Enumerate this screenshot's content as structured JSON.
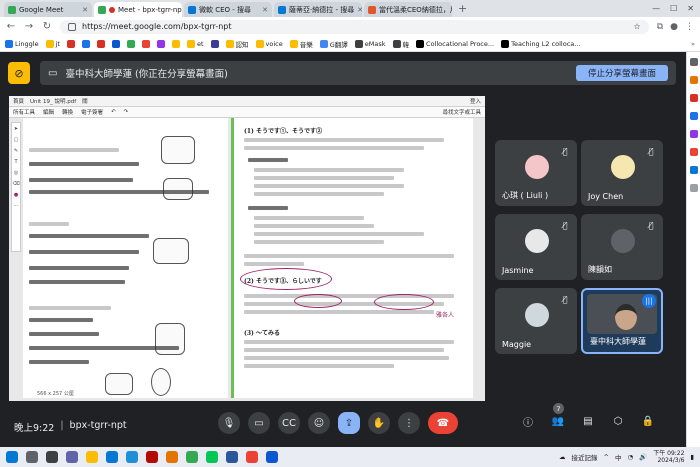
{
  "browser": {
    "tabs": [
      {
        "title": "Google Meet",
        "favicon_color": "#34a853",
        "active": false
      },
      {
        "title": "Meet - bpx-tgrr-npt",
        "favicon_color": "#34a853",
        "active": true
      },
      {
        "title": "微軟 CEO - 搜尋",
        "favicon_color": "#0078d4",
        "active": false
      },
      {
        "title": "薩蒂亞·納德拉 - 搜尋",
        "favicon_color": "#0078d4",
        "active": false
      },
      {
        "title": "當代溫柔CEO納德拉，用…",
        "favicon_color": "#e0572b",
        "active": false
      }
    ],
    "url": "https://meet.google.com/bpx-tgrr-npt",
    "bookmarks": [
      {
        "label": "Linggle",
        "color": "#1a73e8"
      },
      {
        "label": "jt",
        "color": "#fbbc04"
      },
      {
        "label": "",
        "color": "#d93025"
      },
      {
        "label": "",
        "color": "#1a73e8"
      },
      {
        "label": "",
        "color": "#d93025"
      },
      {
        "label": "",
        "color": "#0b57d0"
      },
      {
        "label": "",
        "color": "#34a853"
      },
      {
        "label": "",
        "color": "#ea4335"
      },
      {
        "label": "",
        "color": "#9334e6"
      },
      {
        "label": "",
        "color": "#fbbc04"
      },
      {
        "label": "et",
        "color": "#fbbc04"
      },
      {
        "label": "",
        "color": "#3b3b98"
      },
      {
        "label": "認知",
        "color": "#fbbc04"
      },
      {
        "label": "voice",
        "color": "#fbbc04"
      },
      {
        "label": "音樂",
        "color": "#fbbc04"
      },
      {
        "label": "G翻譯",
        "color": "#4285f4"
      },
      {
        "label": "eMask",
        "color": "#3c4043"
      },
      {
        "label": "韓",
        "color": "#3c4043"
      },
      {
        "label": "Collocational Proce...",
        "color": "#000000"
      },
      {
        "label": "Teaching L2 colloca...",
        "color": "#000000"
      }
    ]
  },
  "meet": {
    "banner_text": "臺中科大師學蓮 (你正在分享螢幕畫面)",
    "stop_share_label": "停止分享螢幕畫面",
    "time": "晚上9:22",
    "separator": "|",
    "meeting_code": "bpx-tgrr-npt",
    "participant_count": "7",
    "participants": [
      {
        "name": "心琪 ( Liuli )",
        "avatar_color": "#f5c6c9"
      },
      {
        "name": "Joy Chen",
        "avatar_color": "#f6e7b0"
      },
      {
        "name": "Jasmine",
        "avatar_color": "#e8e8e8"
      },
      {
        "name": "陳韻如",
        "avatar_color": "#5f6368"
      },
      {
        "name": "Maggie",
        "avatar_color": "#cfd8dc"
      },
      {
        "name": "臺中科大師學蓮",
        "avatar_color": "#c9a58a"
      }
    ]
  },
  "pdf": {
    "file_tab": "Unit 19_ 說明.pdf",
    "close_tab": "關",
    "login": "登入",
    "menu": [
      "所有工具",
      "編輯",
      "轉換",
      "電子簽署"
    ],
    "search_tool": "尋找文字或工具",
    "sections": [
      "(1) そうです①、そうです②",
      "(2) そうです③、らしいです",
      "(3) ～てみる"
    ],
    "handwritten": "雅各人",
    "status": "566 x 257 公厘"
  },
  "taskbar": {
    "weather": "接近記錄",
    "lang": "中",
    "time": "下午 09:22",
    "date": "2024/3/6"
  }
}
